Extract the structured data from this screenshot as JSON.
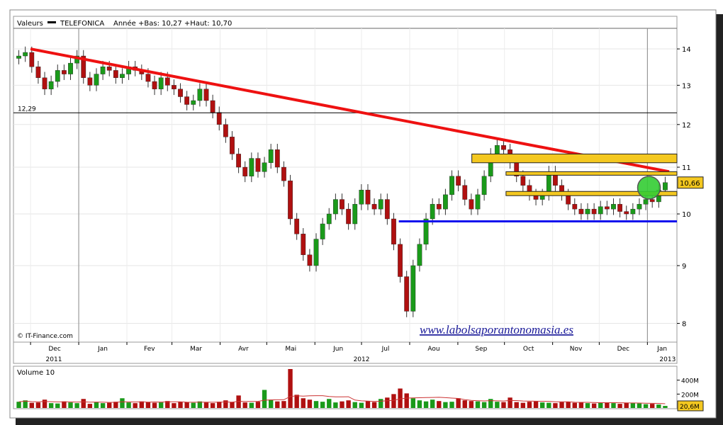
{
  "header": {
    "label": "Valeurs",
    "ticker": "TELEFONICA",
    "range_text": "Année +Bas: 10,27 +Haut: 10,70"
  },
  "copyright": "© IT-Finance.com",
  "watermark": "www.labolsaporantonomasia.es",
  "volume_title": "Volume 10",
  "colors": {
    "up": "#1a9a1a",
    "down": "#b01010",
    "trendline": "#ee1111",
    "support": "#1111ee",
    "zone_fill": "#f4c820",
    "zone_border": "#222222",
    "circle_fill": "#33cc33",
    "price_badge": "#f4c820",
    "background_shadow": "#222222"
  },
  "chart_data": {
    "type": "candlestick",
    "y_axis": {
      "scale": "log",
      "range": [
        7.7,
        14.6
      ],
      "ticks": [
        "14",
        "13",
        "12",
        "11",
        "10",
        "9",
        "8"
      ],
      "position": "right"
    },
    "x_axis": {
      "months": [
        "Dec",
        "Jan",
        "Fev",
        "Mar",
        "Avr",
        "Mai",
        "Jun",
        "Jul",
        "Aou",
        "Sep",
        "Oct",
        "Nov",
        "Dec",
        "Jan"
      ],
      "years": [
        "2011",
        "2012",
        "2013"
      ]
    },
    "reference_line": {
      "label": "12,29",
      "value": 12.29
    },
    "last_price_label": "10,66",
    "last_price": 10.66,
    "trendline": {
      "from": {
        "date": "2011-12-01",
        "value": 14.0
      },
      "to": {
        "date": "2013-01-15",
        "value": 10.9
      }
    },
    "support_line": {
      "from_date": "2012-07-25",
      "value": 9.85
    },
    "resistance_zones": [
      {
        "from_date": "2012-09-10",
        "low": 11.1,
        "high": 11.3
      },
      {
        "from_date": "2012-10-02",
        "low": 10.83,
        "high": 10.9
      },
      {
        "from_date": "2012-10-02",
        "low": 10.38,
        "high": 10.47
      }
    ],
    "highlight_circle": {
      "date": "2013-01-02",
      "value": 10.55
    },
    "closes": [
      13.8,
      13.9,
      13.5,
      13.2,
      12.9,
      13.1,
      13.4,
      13.3,
      13.6,
      13.8,
      13.2,
      13.0,
      13.3,
      13.5,
      13.4,
      13.2,
      13.3,
      13.5,
      13.4,
      13.3,
      13.1,
      12.9,
      13.2,
      13.0,
      12.9,
      12.7,
      12.5,
      12.6,
      12.9,
      12.6,
      12.3,
      12.0,
      11.7,
      11.3,
      11.0,
      10.8,
      11.2,
      10.9,
      11.1,
      11.4,
      11.0,
      10.7,
      9.9,
      9.6,
      9.2,
      9.0,
      9.5,
      9.8,
      10.0,
      10.3,
      10.1,
      9.8,
      10.2,
      10.5,
      10.2,
      10.1,
      10.3,
      9.9,
      9.4,
      8.8,
      8.2,
      9.0,
      9.4,
      9.9,
      10.2,
      10.1,
      10.4,
      10.8,
      10.6,
      10.3,
      10.1,
      10.4,
      10.8,
      11.3,
      11.5,
      11.4,
      11.1,
      10.8,
      10.6,
      10.4,
      10.3,
      10.4,
      10.9,
      10.6,
      10.4,
      10.2,
      10.1,
      10.0,
      10.1,
      10.0,
      10.15,
      10.1,
      10.2,
      10.05,
      10.0,
      10.1,
      10.2,
      10.3,
      10.25,
      10.5,
      10.66
    ],
    "volume_axis": {
      "ticks": [
        "400M",
        "200M"
      ],
      "last_volume_label": "20,6M",
      "last_volume": 20.6
    },
    "volumes": [
      90,
      110,
      75,
      80,
      120,
      70,
      65,
      95,
      80,
      70,
      130,
      60,
      85,
      70,
      75,
      90,
      140,
      80,
      70,
      95,
      85,
      75,
      80,
      100,
      70,
      90,
      85,
      75,
      95,
      80,
      70,
      90,
      110,
      85,
      180,
      80,
      75,
      90,
      260,
      120,
      95,
      100,
      560,
      190,
      140,
      120,
      100,
      90,
      130,
      80,
      95,
      110,
      85,
      75,
      100,
      85,
      130,
      150,
      200,
      280,
      210,
      140,
      110,
      95,
      120,
      100,
      85,
      90,
      140,
      110,
      100,
      95,
      85,
      130,
      90,
      85,
      150,
      85,
      75,
      90,
      95,
      80,
      75,
      70,
      85,
      90,
      75,
      80,
      70,
      65,
      75,
      80,
      70,
      60,
      75,
      70,
      65,
      55,
      60,
      50,
      30
    ]
  }
}
